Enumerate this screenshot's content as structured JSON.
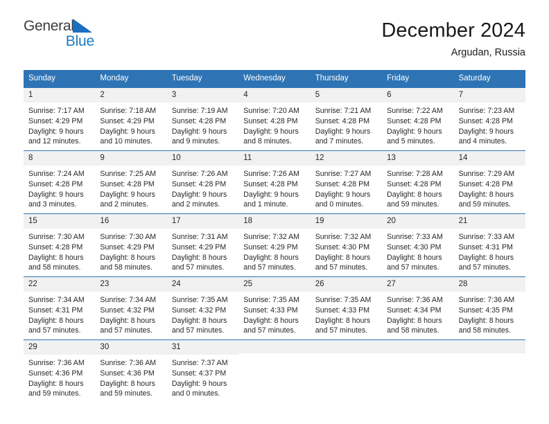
{
  "logo": {
    "word1": "General",
    "word2": "Blue",
    "triangle_color": "#1b6fc0",
    "blue_color": "#1b7bc4"
  },
  "header": {
    "title": "December 2024",
    "location": "Argudan, Russia"
  },
  "theme": {
    "header_blue": "#2e74b5",
    "daynum_gray": "#f1f1f1",
    "text": "#262626"
  },
  "calendar": {
    "weekdays": [
      "Sunday",
      "Monday",
      "Tuesday",
      "Wednesday",
      "Thursday",
      "Friday",
      "Saturday"
    ],
    "weeks": [
      [
        {
          "day": "1",
          "sunrise": "Sunrise: 7:17 AM",
          "sunset": "Sunset: 4:29 PM",
          "daylight": "Daylight: 9 hours and 12 minutes."
        },
        {
          "day": "2",
          "sunrise": "Sunrise: 7:18 AM",
          "sunset": "Sunset: 4:29 PM",
          "daylight": "Daylight: 9 hours and 10 minutes."
        },
        {
          "day": "3",
          "sunrise": "Sunrise: 7:19 AM",
          "sunset": "Sunset: 4:28 PM",
          "daylight": "Daylight: 9 hours and 9 minutes."
        },
        {
          "day": "4",
          "sunrise": "Sunrise: 7:20 AM",
          "sunset": "Sunset: 4:28 PM",
          "daylight": "Daylight: 9 hours and 8 minutes."
        },
        {
          "day": "5",
          "sunrise": "Sunrise: 7:21 AM",
          "sunset": "Sunset: 4:28 PM",
          "daylight": "Daylight: 9 hours and 7 minutes."
        },
        {
          "day": "6",
          "sunrise": "Sunrise: 7:22 AM",
          "sunset": "Sunset: 4:28 PM",
          "daylight": "Daylight: 9 hours and 5 minutes."
        },
        {
          "day": "7",
          "sunrise": "Sunrise: 7:23 AM",
          "sunset": "Sunset: 4:28 PM",
          "daylight": "Daylight: 9 hours and 4 minutes."
        }
      ],
      [
        {
          "day": "8",
          "sunrise": "Sunrise: 7:24 AM",
          "sunset": "Sunset: 4:28 PM",
          "daylight": "Daylight: 9 hours and 3 minutes."
        },
        {
          "day": "9",
          "sunrise": "Sunrise: 7:25 AM",
          "sunset": "Sunset: 4:28 PM",
          "daylight": "Daylight: 9 hours and 2 minutes."
        },
        {
          "day": "10",
          "sunrise": "Sunrise: 7:26 AM",
          "sunset": "Sunset: 4:28 PM",
          "daylight": "Daylight: 9 hours and 2 minutes."
        },
        {
          "day": "11",
          "sunrise": "Sunrise: 7:26 AM",
          "sunset": "Sunset: 4:28 PM",
          "daylight": "Daylight: 9 hours and 1 minute."
        },
        {
          "day": "12",
          "sunrise": "Sunrise: 7:27 AM",
          "sunset": "Sunset: 4:28 PM",
          "daylight": "Daylight: 9 hours and 0 minutes."
        },
        {
          "day": "13",
          "sunrise": "Sunrise: 7:28 AM",
          "sunset": "Sunset: 4:28 PM",
          "daylight": "Daylight: 8 hours and 59 minutes."
        },
        {
          "day": "14",
          "sunrise": "Sunrise: 7:29 AM",
          "sunset": "Sunset: 4:28 PM",
          "daylight": "Daylight: 8 hours and 59 minutes."
        }
      ],
      [
        {
          "day": "15",
          "sunrise": "Sunrise: 7:30 AM",
          "sunset": "Sunset: 4:28 PM",
          "daylight": "Daylight: 8 hours and 58 minutes."
        },
        {
          "day": "16",
          "sunrise": "Sunrise: 7:30 AM",
          "sunset": "Sunset: 4:29 PM",
          "daylight": "Daylight: 8 hours and 58 minutes."
        },
        {
          "day": "17",
          "sunrise": "Sunrise: 7:31 AM",
          "sunset": "Sunset: 4:29 PM",
          "daylight": "Daylight: 8 hours and 57 minutes."
        },
        {
          "day": "18",
          "sunrise": "Sunrise: 7:32 AM",
          "sunset": "Sunset: 4:29 PM",
          "daylight": "Daylight: 8 hours and 57 minutes."
        },
        {
          "day": "19",
          "sunrise": "Sunrise: 7:32 AM",
          "sunset": "Sunset: 4:30 PM",
          "daylight": "Daylight: 8 hours and 57 minutes."
        },
        {
          "day": "20",
          "sunrise": "Sunrise: 7:33 AM",
          "sunset": "Sunset: 4:30 PM",
          "daylight": "Daylight: 8 hours and 57 minutes."
        },
        {
          "day": "21",
          "sunrise": "Sunrise: 7:33 AM",
          "sunset": "Sunset: 4:31 PM",
          "daylight": "Daylight: 8 hours and 57 minutes."
        }
      ],
      [
        {
          "day": "22",
          "sunrise": "Sunrise: 7:34 AM",
          "sunset": "Sunset: 4:31 PM",
          "daylight": "Daylight: 8 hours and 57 minutes."
        },
        {
          "day": "23",
          "sunrise": "Sunrise: 7:34 AM",
          "sunset": "Sunset: 4:32 PM",
          "daylight": "Daylight: 8 hours and 57 minutes."
        },
        {
          "day": "24",
          "sunrise": "Sunrise: 7:35 AM",
          "sunset": "Sunset: 4:32 PM",
          "daylight": "Daylight: 8 hours and 57 minutes."
        },
        {
          "day": "25",
          "sunrise": "Sunrise: 7:35 AM",
          "sunset": "Sunset: 4:33 PM",
          "daylight": "Daylight: 8 hours and 57 minutes."
        },
        {
          "day": "26",
          "sunrise": "Sunrise: 7:35 AM",
          "sunset": "Sunset: 4:33 PM",
          "daylight": "Daylight: 8 hours and 57 minutes."
        },
        {
          "day": "27",
          "sunrise": "Sunrise: 7:36 AM",
          "sunset": "Sunset: 4:34 PM",
          "daylight": "Daylight: 8 hours and 58 minutes."
        },
        {
          "day": "28",
          "sunrise": "Sunrise: 7:36 AM",
          "sunset": "Sunset: 4:35 PM",
          "daylight": "Daylight: 8 hours and 58 minutes."
        }
      ],
      [
        {
          "day": "29",
          "sunrise": "Sunrise: 7:36 AM",
          "sunset": "Sunset: 4:36 PM",
          "daylight": "Daylight: 8 hours and 59 minutes."
        },
        {
          "day": "30",
          "sunrise": "Sunrise: 7:36 AM",
          "sunset": "Sunset: 4:36 PM",
          "daylight": "Daylight: 8 hours and 59 minutes."
        },
        {
          "day": "31",
          "sunrise": "Sunrise: 7:37 AM",
          "sunset": "Sunset: 4:37 PM",
          "daylight": "Daylight: 9 hours and 0 minutes."
        },
        {
          "day": "",
          "sunrise": "",
          "sunset": "",
          "daylight": ""
        },
        {
          "day": "",
          "sunrise": "",
          "sunset": "",
          "daylight": ""
        },
        {
          "day": "",
          "sunrise": "",
          "sunset": "",
          "daylight": ""
        },
        {
          "day": "",
          "sunrise": "",
          "sunset": "",
          "daylight": ""
        }
      ]
    ]
  }
}
